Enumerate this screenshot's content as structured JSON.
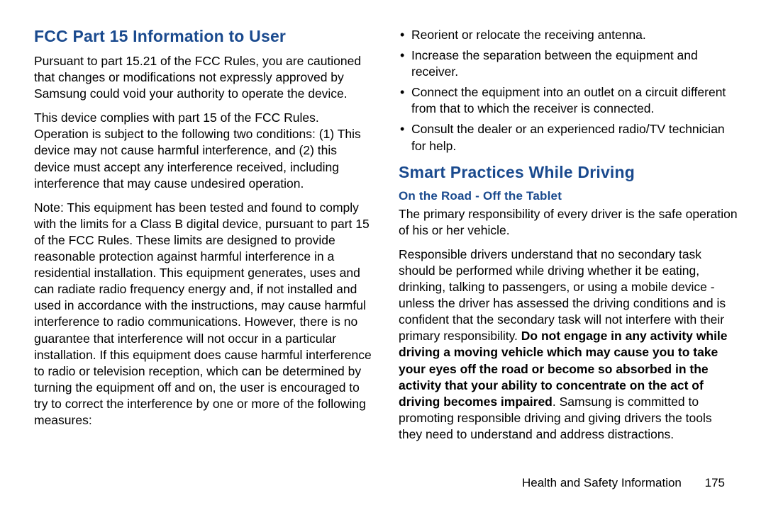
{
  "left": {
    "heading": "FCC Part 15 Information to User",
    "p1": "Pursuant to part 15.21 of the FCC Rules, you are cautioned that changes or modifications not expressly approved by Samsung could void your authority to operate the device.",
    "p2": "This device complies with part 15 of the FCC Rules. Operation is subject to the following two conditions: (1) This device may not cause harmful interference, and (2) this device must accept any interference received, including interference that may cause undesired operation.",
    "p3": "Note: This equipment has been tested and found to comply with the limits for a Class B digital device, pursuant to part 15 of the FCC Rules. These limits are designed to provide reasonable protection against harmful interference in a residential installation. This equipment generates, uses and can radiate radio frequency energy and, if not installed and used in accordance with the instructions, may cause harmful interference to radio communications. However, there is no guarantee that interference will not occur in a particular installation. If this equipment does cause harmful interference to radio or television reception, which can be determined by turning the equipment off and on, the user is encouraged to try to correct the interference by one or more of the following measures:"
  },
  "right": {
    "bullets": [
      "Reorient or relocate the receiving antenna.",
      "Increase the separation between the equipment and receiver.",
      "Connect the equipment into an outlet on a circuit different from that to which the receiver is connected.",
      "Consult the dealer or an experienced radio/TV technician for help."
    ],
    "heading": "Smart Practices While Driving",
    "subheading": "On the Road - Off the Tablet",
    "p1": "The primary responsibility of every driver is the safe operation of his or her vehicle.",
    "p2_intro": "Responsible drivers understand that no secondary task should be performed while driving whether it be eating, drinking, talking to passengers, or using a mobile device - unless the driver has assessed the driving conditions and is confident that the secondary task will not interfere with their primary responsibility. ",
    "p2_bold": "Do not engage in any activity while driving a moving vehicle which may cause you to take your eyes off the road or become so absorbed in the activity that your ability to concentrate on the act of driving becomes impaired",
    "p2_outro": ". Samsung is committed to promoting responsible driving and giving drivers the tools they need to understand and address distractions."
  },
  "footer": {
    "label": "Health and Safety Information",
    "page": "175"
  }
}
